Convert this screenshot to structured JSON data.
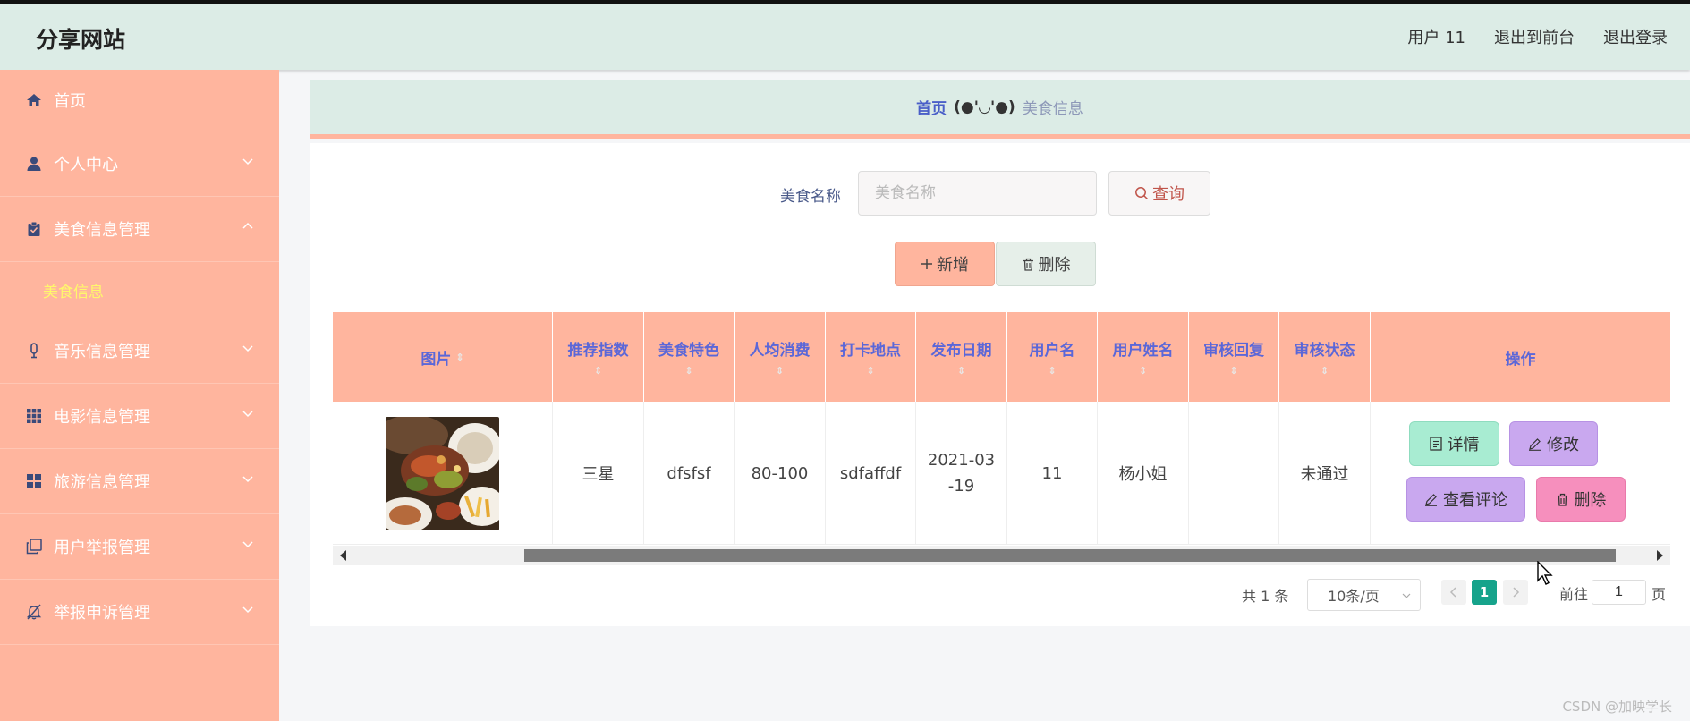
{
  "app": {
    "title": "分享网站"
  },
  "topbar": {
    "user": "用户 11",
    "to_front": "退出到前台",
    "logout": "退出登录"
  },
  "sidebar": {
    "items": [
      {
        "label": "首页",
        "icon": "home-icon"
      },
      {
        "label": "个人中心",
        "icon": "user-icon"
      },
      {
        "label": "美食信息管理",
        "icon": "clipboard-icon",
        "expanded": true,
        "sub": "美食信息"
      },
      {
        "label": "音乐信息管理",
        "icon": "mic-icon"
      },
      {
        "label": "电影信息管理",
        "icon": "grid-icon"
      },
      {
        "label": "旅游信息管理",
        "icon": "apps-icon"
      },
      {
        "label": "用户举报管理",
        "icon": "copy-icon"
      },
      {
        "label": "举报申诉管理",
        "icon": "bell-off-icon"
      }
    ]
  },
  "breadcrumb": {
    "home": "首页",
    "sep": "(●'◡'●)",
    "current": "美食信息"
  },
  "search": {
    "label": "美食名称",
    "placeholder": "美食名称",
    "button": "查询"
  },
  "actions": {
    "add": "新增",
    "delete": "删除"
  },
  "table": {
    "columns": [
      "图片",
      "推荐指数",
      "美食特色",
      "人均消费",
      "打卡地点",
      "发布日期",
      "用户名",
      "用户姓名",
      "审核回复",
      "审核状态",
      "操作"
    ],
    "rows": [
      {
        "rating": "三星",
        "feature": "dfsfsf",
        "cost": "80-100",
        "location": "sdfaffdf",
        "date_line1": "2021-03",
        "date_line2": "-19",
        "username": "11",
        "realname": "杨小姐",
        "reply": "",
        "status": "未通过"
      }
    ],
    "ops": {
      "detail": "详情",
      "edit": "修改",
      "comment": "查看评论",
      "delete": "删除"
    }
  },
  "pagination": {
    "total": "共 1 条",
    "page_size": "10条/页",
    "current": "1",
    "goto_prefix": "前往",
    "goto_value": "1",
    "goto_suffix": "页"
  },
  "watermark": "CSDN @加映学长",
  "colors": {
    "sidebar": "#ffb59e",
    "header": "#dcece6",
    "accent": "#16a38b",
    "submenu_active": "#fff86b"
  }
}
